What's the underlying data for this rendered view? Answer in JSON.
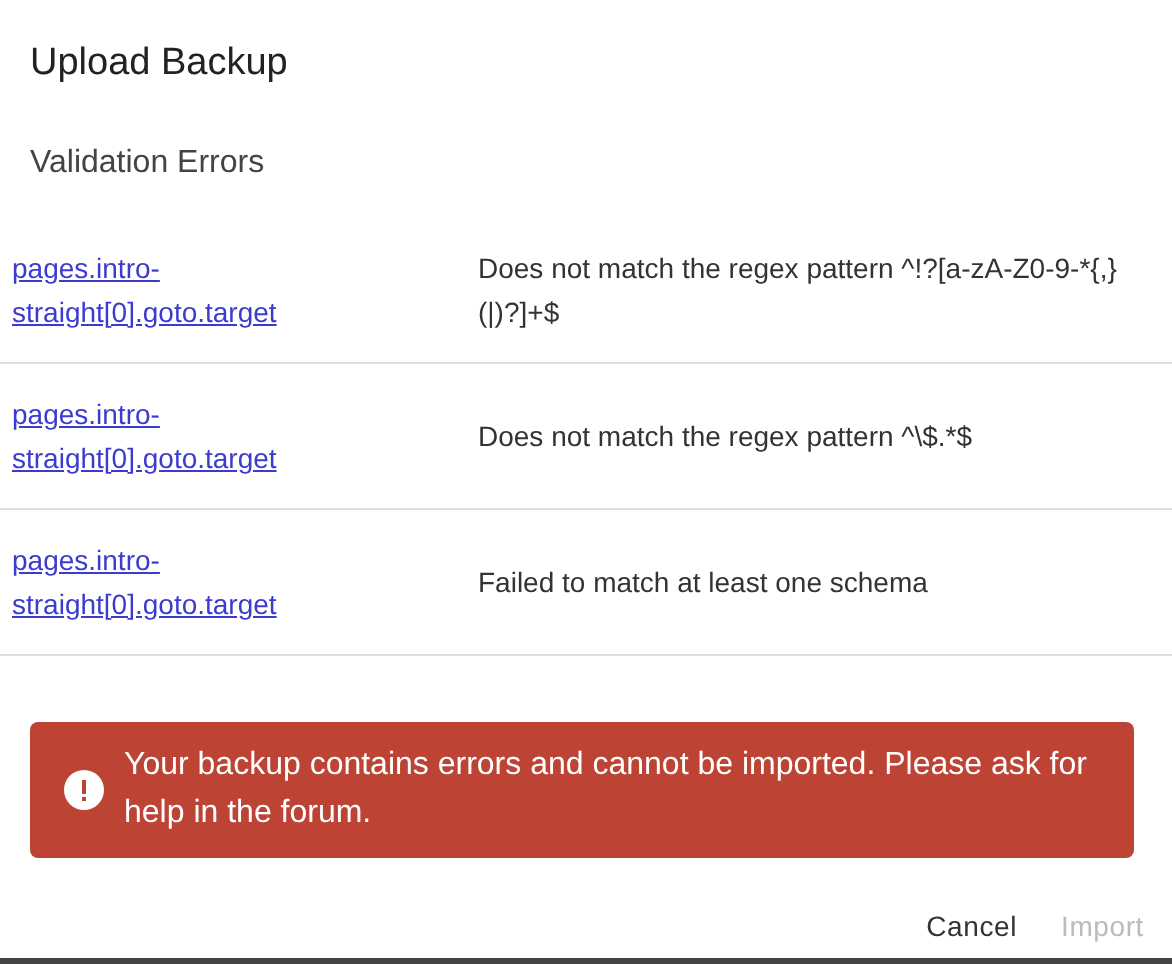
{
  "dialog": {
    "title": "Upload Backup",
    "subtitle": "Validation Errors"
  },
  "errors": [
    {
      "path": "pages.intro-straight[0].goto.target",
      "message": "Does not match the regex pattern ^!?[a-zA-Z0-9-*{,}(|)?]+$"
    },
    {
      "path": "pages.intro-straight[0].goto.target",
      "message": "Does not match the regex pattern ^\\$.*$"
    },
    {
      "path": "pages.intro-straight[0].goto.target",
      "message": "Failed to match at least one schema"
    }
  ],
  "alert": {
    "kind": "error",
    "text": "Your backup contains errors and cannot be imported. Please ask for help in the forum."
  },
  "buttons": [
    {
      "label": "Cancel",
      "disabled": false
    },
    {
      "label": "Import",
      "disabled": true
    }
  ]
}
